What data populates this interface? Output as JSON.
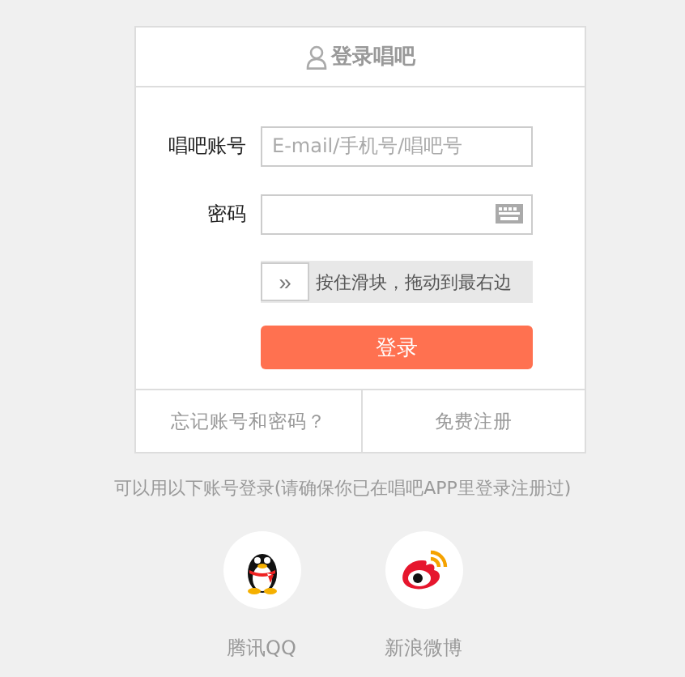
{
  "card": {
    "title": "登录唱吧",
    "fields": [
      {
        "kind": "text",
        "label": "唱吧账号",
        "placeholder": "E-mail/手机号/唱吧号"
      },
      {
        "kind": "password",
        "label": "密码"
      }
    ],
    "slider": {
      "hint": "按住滑块，拖动到最右边",
      "handle": "»"
    },
    "submit": "登录",
    "links": [
      "忘记账号和密码？",
      "免费注册"
    ]
  },
  "social": {
    "note": "可以用以下账号登录(请确保你已在唱吧APP里登录注册过)",
    "options": [
      {
        "kind": "penguin",
        "label": "腾讯QQ"
      },
      {
        "kind": "eye",
        "label": "新浪微博"
      }
    ]
  }
}
